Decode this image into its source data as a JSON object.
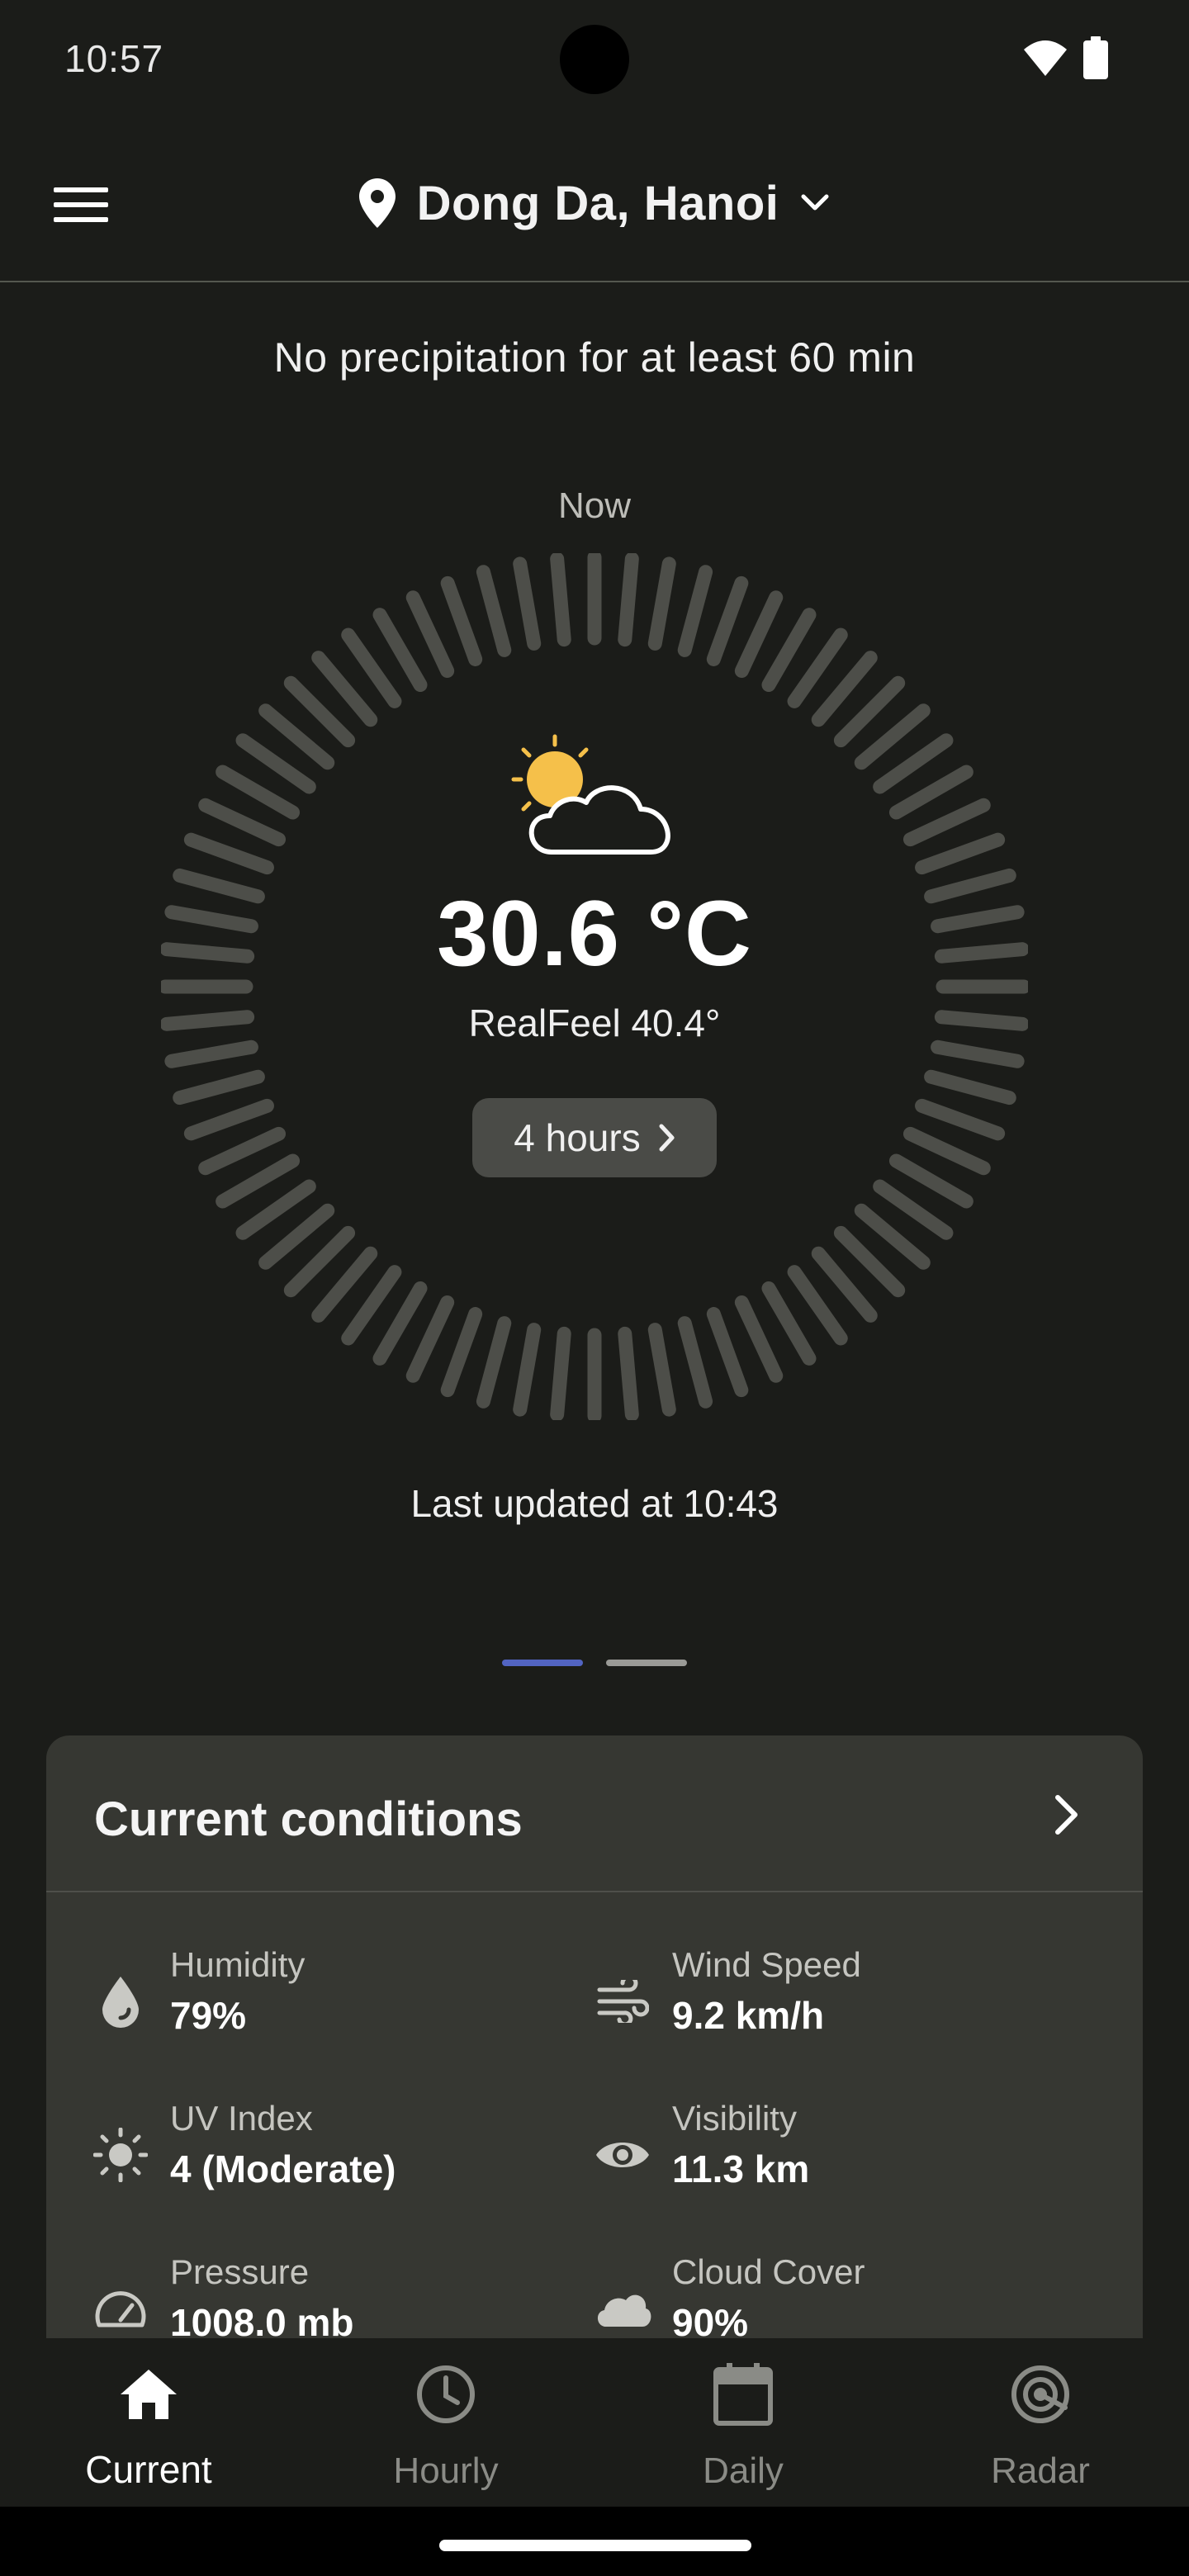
{
  "status_bar": {
    "time": "10:57",
    "wifi_icon": "wifi-icon",
    "battery_icon": "battery-icon"
  },
  "app_bar": {
    "menu_icon": "menu-icon",
    "location_icon": "location-pin-icon",
    "location": "Dong Da, Hanoi",
    "dropdown_icon": "chevron-down-icon"
  },
  "precipitation": "No precipitation for at least 60 min",
  "dial": {
    "now_label": "Now",
    "icon": "partly-cloudy-day-icon",
    "temperature": "30.6 °C",
    "realfeel": "RealFeel 40.4°",
    "hours_button": "4 hours"
  },
  "last_updated": "Last updated at 10:43",
  "pager": {
    "pages": 2,
    "active_page": 1
  },
  "current_conditions": {
    "title": "Current conditions",
    "items": [
      {
        "label": "Humidity",
        "value": "79%",
        "icon": "water-drop-icon"
      },
      {
        "label": "Wind Speed",
        "value": "9.2 km/h",
        "icon": "wind-icon"
      },
      {
        "label": "UV Index",
        "value": "4 (Moderate)",
        "icon": "sun-icon"
      },
      {
        "label": "Visibility",
        "value": "11.3 km",
        "icon": "eye-icon"
      },
      {
        "label": "Pressure",
        "value": "1008.0 mb",
        "icon": "gauge-icon"
      },
      {
        "label": "Cloud Cover",
        "value": "90%",
        "icon": "cloud-icon"
      }
    ]
  },
  "bottom_nav": [
    {
      "label": "Current",
      "icon": "home-icon",
      "active": true
    },
    {
      "label": "Hourly",
      "icon": "clock-icon",
      "active": false
    },
    {
      "label": "Daily",
      "icon": "calendar-icon",
      "active": false
    },
    {
      "label": "Radar",
      "icon": "radar-icon",
      "active": false
    }
  ],
  "colors": {
    "background": "#1b1c19",
    "card": "#363732",
    "dial_tick": "#4d4e49",
    "accent_dot": "#5264c2",
    "sun": "#f5c04a"
  }
}
